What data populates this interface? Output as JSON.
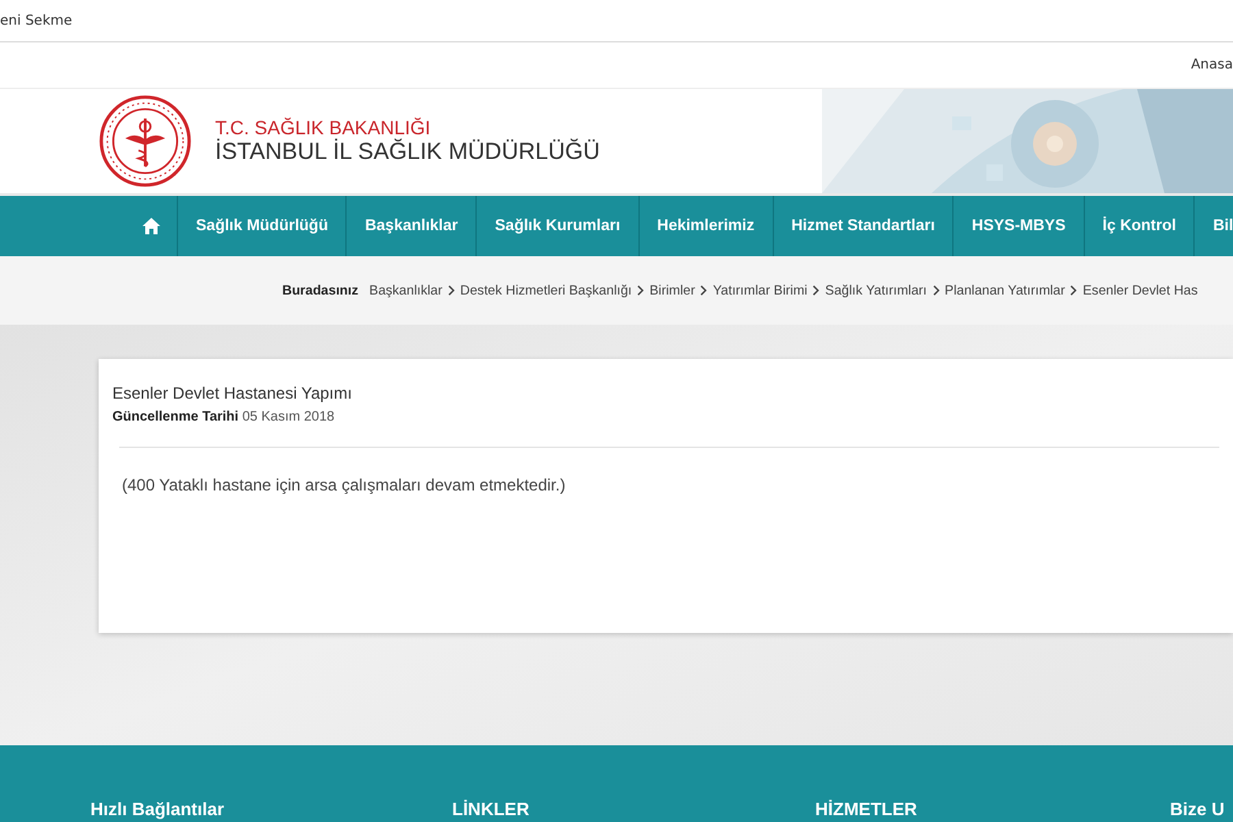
{
  "browser_tab": {
    "title": "eni Sekme"
  },
  "top_links": [
    "Anasa"
  ],
  "header": {
    "ministry": "T.C. SAĞLIK BAKANLIĞI",
    "directorate": "İSTANBUL İL SAĞLIK MÜDÜRLÜĞÜ"
  },
  "nav": {
    "items": [
      {
        "kind": "home"
      },
      {
        "kind": "text",
        "label": "Sağlık Müdürlüğü"
      },
      {
        "kind": "text",
        "label": "Başkanlıklar"
      },
      {
        "kind": "text",
        "label": "Sağlık Kurumları"
      },
      {
        "kind": "text",
        "label": "Hekimlerimiz"
      },
      {
        "kind": "text",
        "label": "Hizmet Standartları"
      },
      {
        "kind": "text",
        "label": "HSYS-MBYS"
      },
      {
        "kind": "text",
        "label": "İç Kontrol"
      },
      {
        "kind": "text",
        "label": "Bil"
      }
    ]
  },
  "breadcrumb": {
    "label": "Buradasınız",
    "items": [
      "Başkanlıklar",
      "Destek Hizmetleri Başkanlığı",
      "Birimler",
      "Yatırımlar Birimi",
      "Sağlık Yatırımları",
      "Planlanan Yatırımlar",
      "Esenler Devlet Has"
    ]
  },
  "article": {
    "title": "Esenler Devlet Hastanesi Yapımı",
    "updated_label": "Güncellenme Tarihi",
    "updated_date": "05 Kasım 2018",
    "body": "(400 Yataklı hastane için arsa çalışmaları devam etmektedir.)"
  },
  "footer": {
    "headings": [
      "Hızlı Bağlantılar",
      "LİNKLER",
      "HİZMETLER",
      "Bize U"
    ]
  }
}
